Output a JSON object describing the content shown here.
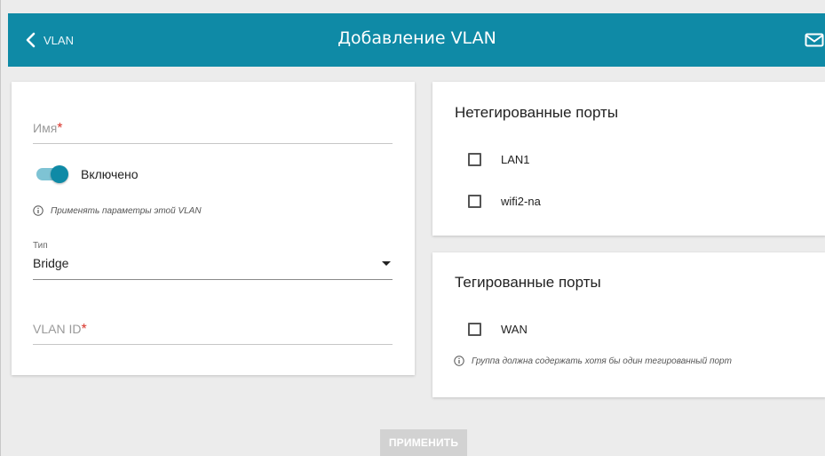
{
  "header": {
    "back_label": "VLAN",
    "title": "Добавление VLAN",
    "accent_color": "#0f8aa6"
  },
  "form": {
    "name_label": "Имя",
    "name_required_mark": "*",
    "toggle_label": "Включено",
    "toggle_on": true,
    "apply_hint": "Применять параметры этой VLAN",
    "type_label": "Тип",
    "type_value": "Bridge",
    "vlan_id_label": "VLAN ID",
    "vlan_id_required_mark": "*"
  },
  "untagged": {
    "title": "Нетегированные порты",
    "ports": [
      {
        "label": "LAN1",
        "checked": false
      },
      {
        "label": "wifi2-na",
        "checked": false
      }
    ]
  },
  "tagged": {
    "title": "Тегированные порты",
    "ports": [
      {
        "label": "WAN",
        "checked": false
      }
    ],
    "hint": "Группа должна содержать хотя бы один тегированный порт"
  },
  "actions": {
    "apply_label": "ПРИМЕНИТЬ"
  },
  "icons": {
    "back": "chevron-left-icon",
    "mail": "mail-icon",
    "info": "info-icon",
    "dropdown": "caret-down-icon"
  }
}
